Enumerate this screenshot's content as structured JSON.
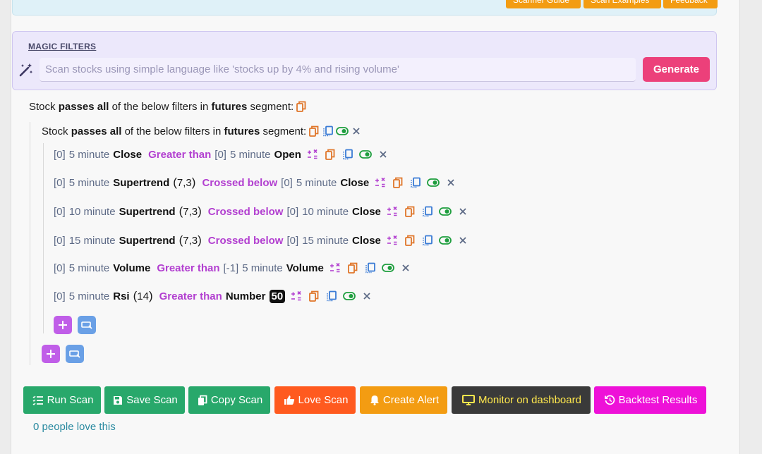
{
  "top_buttons": [
    "Scanner Guide",
    "Scan Examples",
    "Feedback"
  ],
  "magic": {
    "title": "MAGIC FILTERS",
    "placeholder": "Scan stocks using simple language like 'stocks up by 4% and rising volume'",
    "generate_label": "Generate"
  },
  "outer_group": {
    "prefix": "Stock",
    "passes": "passes all",
    "middle": "of the below filters in",
    "segment": "futures",
    "suffix": "segment:"
  },
  "inner_group": {
    "prefix": "Stock",
    "passes": "passes all",
    "middle": "of the below filters in",
    "segment": "futures",
    "suffix": "segment:"
  },
  "conditions": [
    {
      "l_off": "[0]",
      "l_tf": "5 minute",
      "l_name": "Close",
      "l_args": "",
      "op": "Greater than",
      "r_off": "[0]",
      "r_tf": "5 minute",
      "r_name": "Open",
      "r_args": ""
    },
    {
      "l_off": "[0]",
      "l_tf": "5 minute",
      "l_name": "Supertrend",
      "l_args": "7,3",
      "op": "Crossed below",
      "r_off": "[0]",
      "r_tf": "5 minute",
      "r_name": "Close",
      "r_args": ""
    },
    {
      "l_off": "[0]",
      "l_tf": "10 minute",
      "l_name": "Supertrend",
      "l_args": "7,3",
      "op": "Crossed below",
      "r_off": "[0]",
      "r_tf": "10 minute",
      "r_name": "Close",
      "r_args": ""
    },
    {
      "l_off": "[0]",
      "l_tf": "15 minute",
      "l_name": "Supertrend",
      "l_args": "7,3",
      "op": "Crossed below",
      "r_off": "[0]",
      "r_tf": "15 minute",
      "r_name": "Close",
      "r_args": ""
    },
    {
      "l_off": "[0]",
      "l_tf": "5 minute",
      "l_name": "Volume",
      "l_args": "",
      "op": "Greater than",
      "r_off": "[-1]",
      "r_tf": "5 minute",
      "r_name": "Volume",
      "r_args": ""
    },
    {
      "l_off": "[0]",
      "l_tf": "5 minute",
      "l_name": "Rsi",
      "l_args": "14",
      "op": "Greater than",
      "r_off": "",
      "r_tf": "",
      "r_name": "Number",
      "r_args": "",
      "r_value": "50"
    }
  ],
  "actions": [
    {
      "label": "Run Scan",
      "icon": "list-icon",
      "color": "#28a86b",
      "text_color": "#ffffff"
    },
    {
      "label": "Save Scan",
      "icon": "save-icon",
      "color": "#28a86b",
      "text_color": "#ffffff"
    },
    {
      "label": "Copy Scan",
      "icon": "copy-icon",
      "color": "#28a86b",
      "text_color": "#ffffff"
    },
    {
      "label": "Love Scan",
      "icon": "thumbs-up-icon",
      "color": "#ff5a1f",
      "text_color": "#ffffff"
    },
    {
      "label": "Create Alert",
      "icon": "bell-icon",
      "color": "#f39c12",
      "text_color": "#ffffff"
    },
    {
      "label": "Monitor on dashboard",
      "icon": "monitor-icon",
      "color": "#3a3a3a",
      "text_color": "#ffe84d"
    },
    {
      "label": "Backtest Results",
      "icon": "history-icon",
      "color": "#ee11d8",
      "text_color": "#ffffff"
    }
  ],
  "love_count_text": "0 people love this",
  "colors": {
    "operator": "#b23fd0",
    "generate": "#ec407a",
    "copy_icon": "#e0762a",
    "duplicate_icon": "#3a7bd5",
    "toggle_icon": "#1e9e3e"
  }
}
